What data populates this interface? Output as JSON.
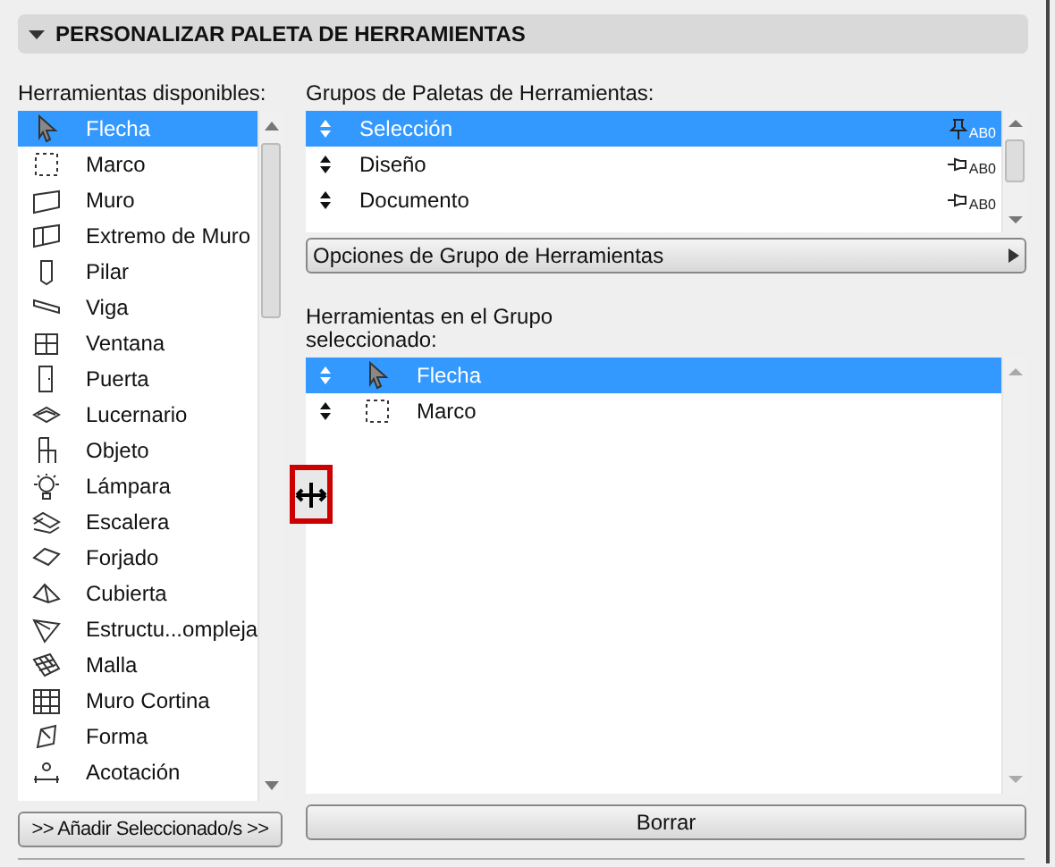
{
  "section": {
    "title": "PERSONALIZAR PALETA DE HERRAMIENTAS",
    "expanded": true
  },
  "available": {
    "label": "Herramientas disponibles:",
    "items": [
      {
        "label": "Flecha",
        "selected": true
      },
      {
        "label": "Marco",
        "selected": false
      },
      {
        "label": "Muro",
        "selected": false
      },
      {
        "label": "Extremo de Muro",
        "selected": false
      },
      {
        "label": "Pilar",
        "selected": false
      },
      {
        "label": "Viga",
        "selected": false
      },
      {
        "label": "Ventana",
        "selected": false
      },
      {
        "label": "Puerta",
        "selected": false
      },
      {
        "label": "Lucernario",
        "selected": false
      },
      {
        "label": "Objeto",
        "selected": false
      },
      {
        "label": "Lámpara",
        "selected": false
      },
      {
        "label": "Escalera",
        "selected": false
      },
      {
        "label": "Forjado",
        "selected": false
      },
      {
        "label": "Cubierta",
        "selected": false
      },
      {
        "label": "Estructu...ompleja",
        "selected": false
      },
      {
        "label": "Malla",
        "selected": false
      },
      {
        "label": "Muro Cortina",
        "selected": false
      },
      {
        "label": "Forma",
        "selected": false
      },
      {
        "label": "Acotación",
        "selected": false
      }
    ],
    "add_button": ">> Añadir Seleccionado/s >>"
  },
  "groups": {
    "label": "Grupos de Paletas de Herramientas:",
    "items": [
      {
        "label": "Selección",
        "selected": true,
        "pinned": true,
        "tag": "AB0"
      },
      {
        "label": "Diseño",
        "selected": false,
        "pinned": false,
        "tag": "AB0"
      },
      {
        "label": "Documento",
        "selected": false,
        "pinned": false,
        "tag": "AB0"
      }
    ],
    "options_button": "Opciones de Grupo de Herramientas"
  },
  "group_tools": {
    "label": "Herramientas en el Grupo seleccionado:",
    "items": [
      {
        "label": "Flecha",
        "selected": true
      },
      {
        "label": "Marco",
        "selected": false
      }
    ],
    "delete_button": "Borrar"
  }
}
